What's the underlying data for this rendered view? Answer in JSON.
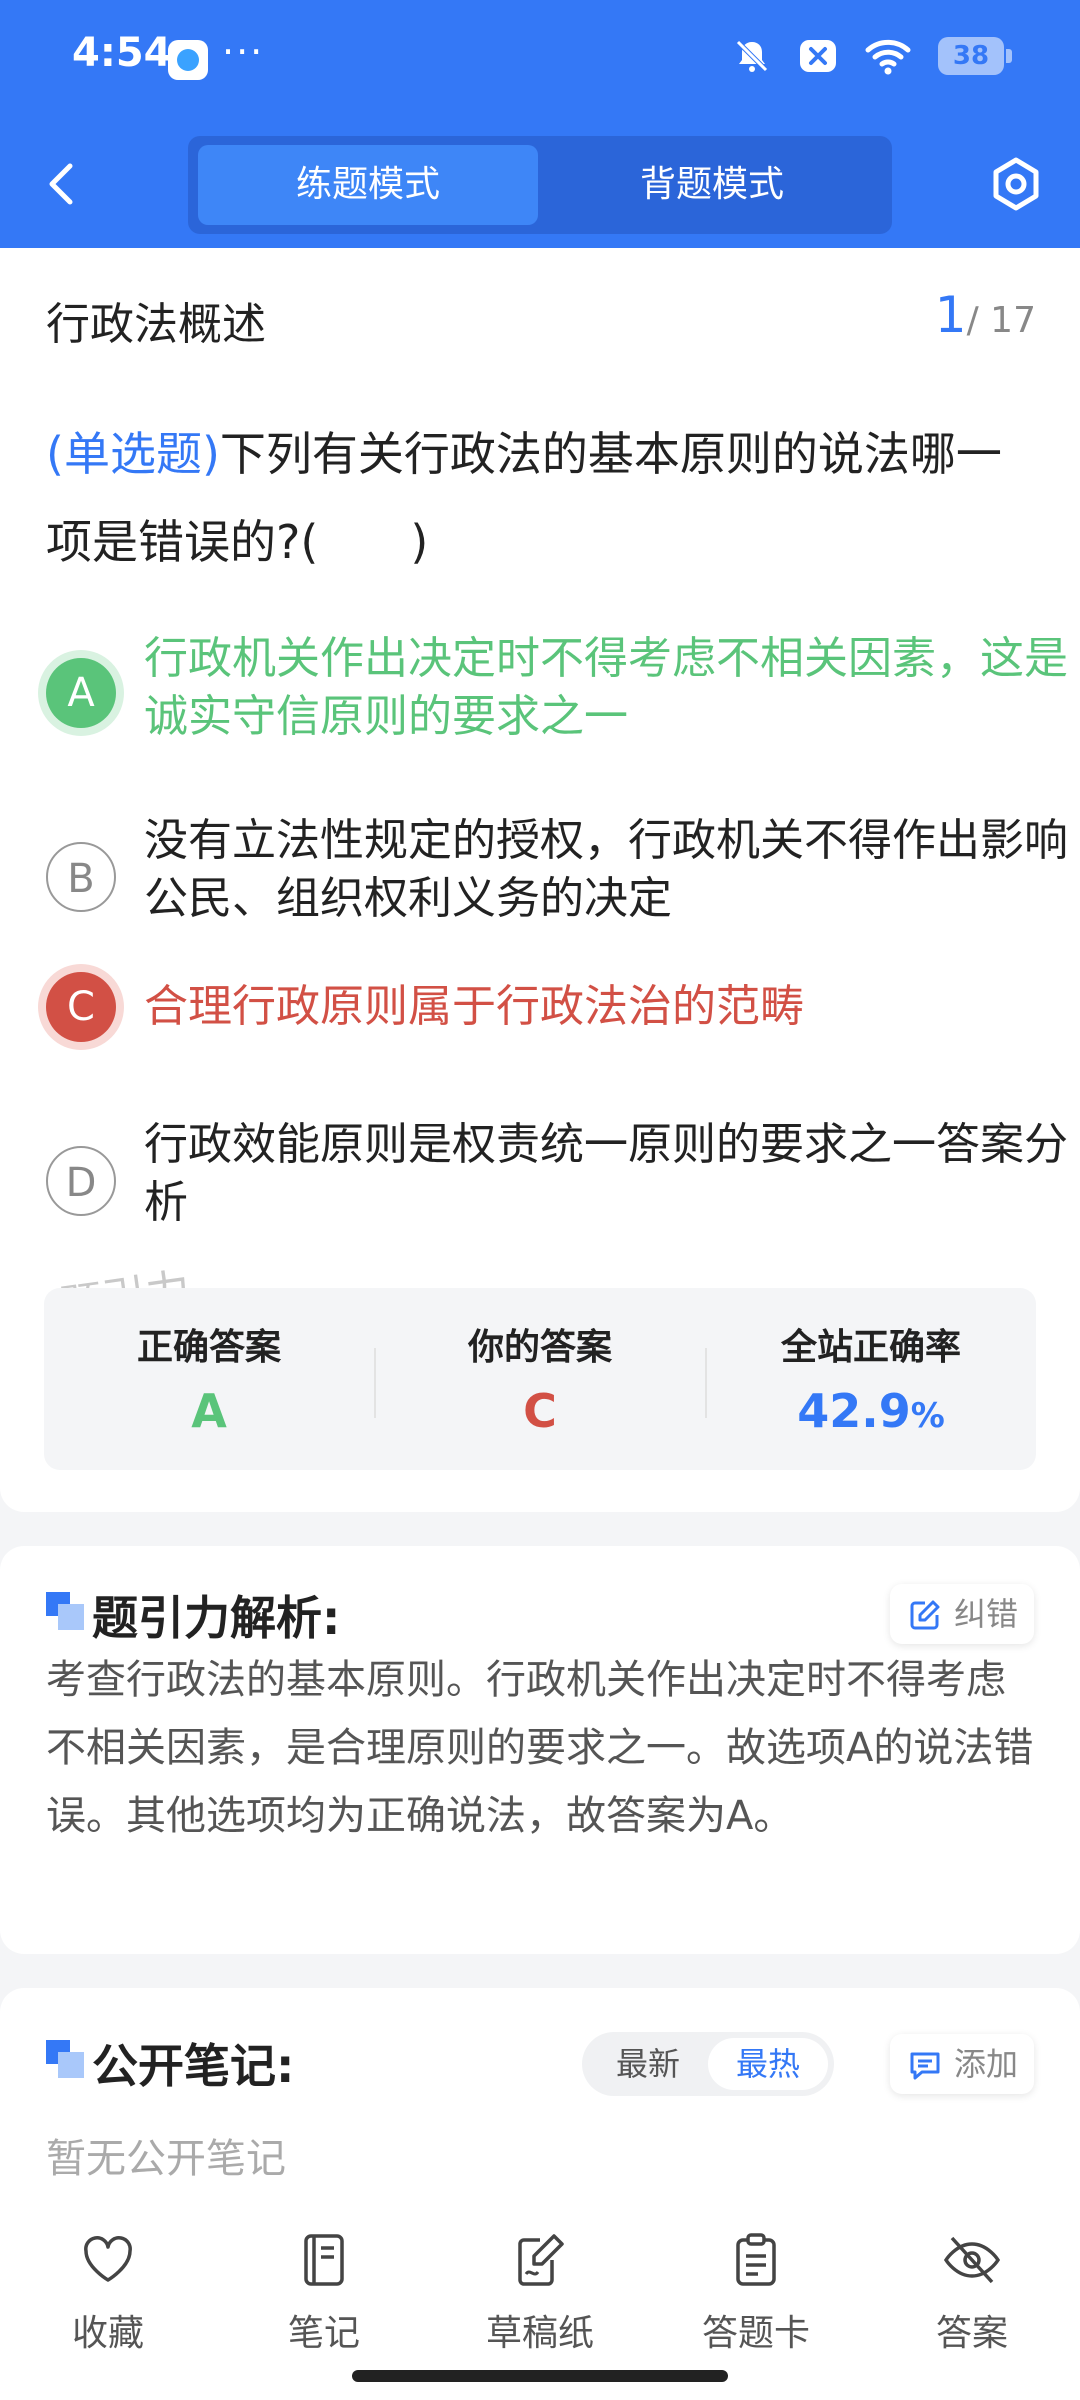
{
  "status_bar": {
    "time": "4:54",
    "more": "···",
    "battery": "38"
  },
  "header": {
    "tabs": [
      {
        "label": "练题模式",
        "active": true
      },
      {
        "label": "背题模式",
        "active": false
      }
    ]
  },
  "section": {
    "title": "行政法概述",
    "current": "1",
    "total": "/ 17"
  },
  "question": {
    "type": "(单选题)",
    "text": "下列有关行政法的基本原则的说法哪一项是错误的?(　　)",
    "options": [
      {
        "letter": "A",
        "text": "行政机关作出决定时不得考虑不相关因素，这是诚实守信原则的要求之一",
        "state": "correct"
      },
      {
        "letter": "B",
        "text": "没有立法性规定的授权，行政机关不得作出影响公民、组织权利义务的决定",
        "state": "normal"
      },
      {
        "letter": "C",
        "text": "合理行政原则属于行政法治的范畴",
        "state": "wrong"
      },
      {
        "letter": "D",
        "text": "行政效能原则是权责统一原则的要求之一答案分析",
        "state": "normal"
      }
    ]
  },
  "watermark": "题引力",
  "stats": {
    "correct_label": "正确答案",
    "correct_value": "A",
    "yours_label": "你的答案",
    "yours_value": "C",
    "rate_label": "全站正确率",
    "rate_value": "42.9",
    "rate_unit": "%"
  },
  "analysis": {
    "title": "题引力解析:",
    "report_label": "纠错",
    "text": "考查行政法的基本原则。行政机关作出决定时不得考虑不相关因素，是合理原则的要求之一。故选项A的说法错误。其他选项均为正确说法，故答案为A。"
  },
  "notes": {
    "title": "公开笔记:",
    "sort_new": "最新",
    "sort_hot": "最热",
    "add_label": "添加",
    "empty_text": "暂无公开笔记"
  },
  "bottom_nav": {
    "favorite": "收藏",
    "notes": "笔记",
    "draft": "草稿纸",
    "answer_card": "答题卡",
    "answer": "答案"
  },
  "colors": {
    "primary": "#3478f6",
    "correct": "#5ac47a",
    "wrong": "#d25045"
  }
}
